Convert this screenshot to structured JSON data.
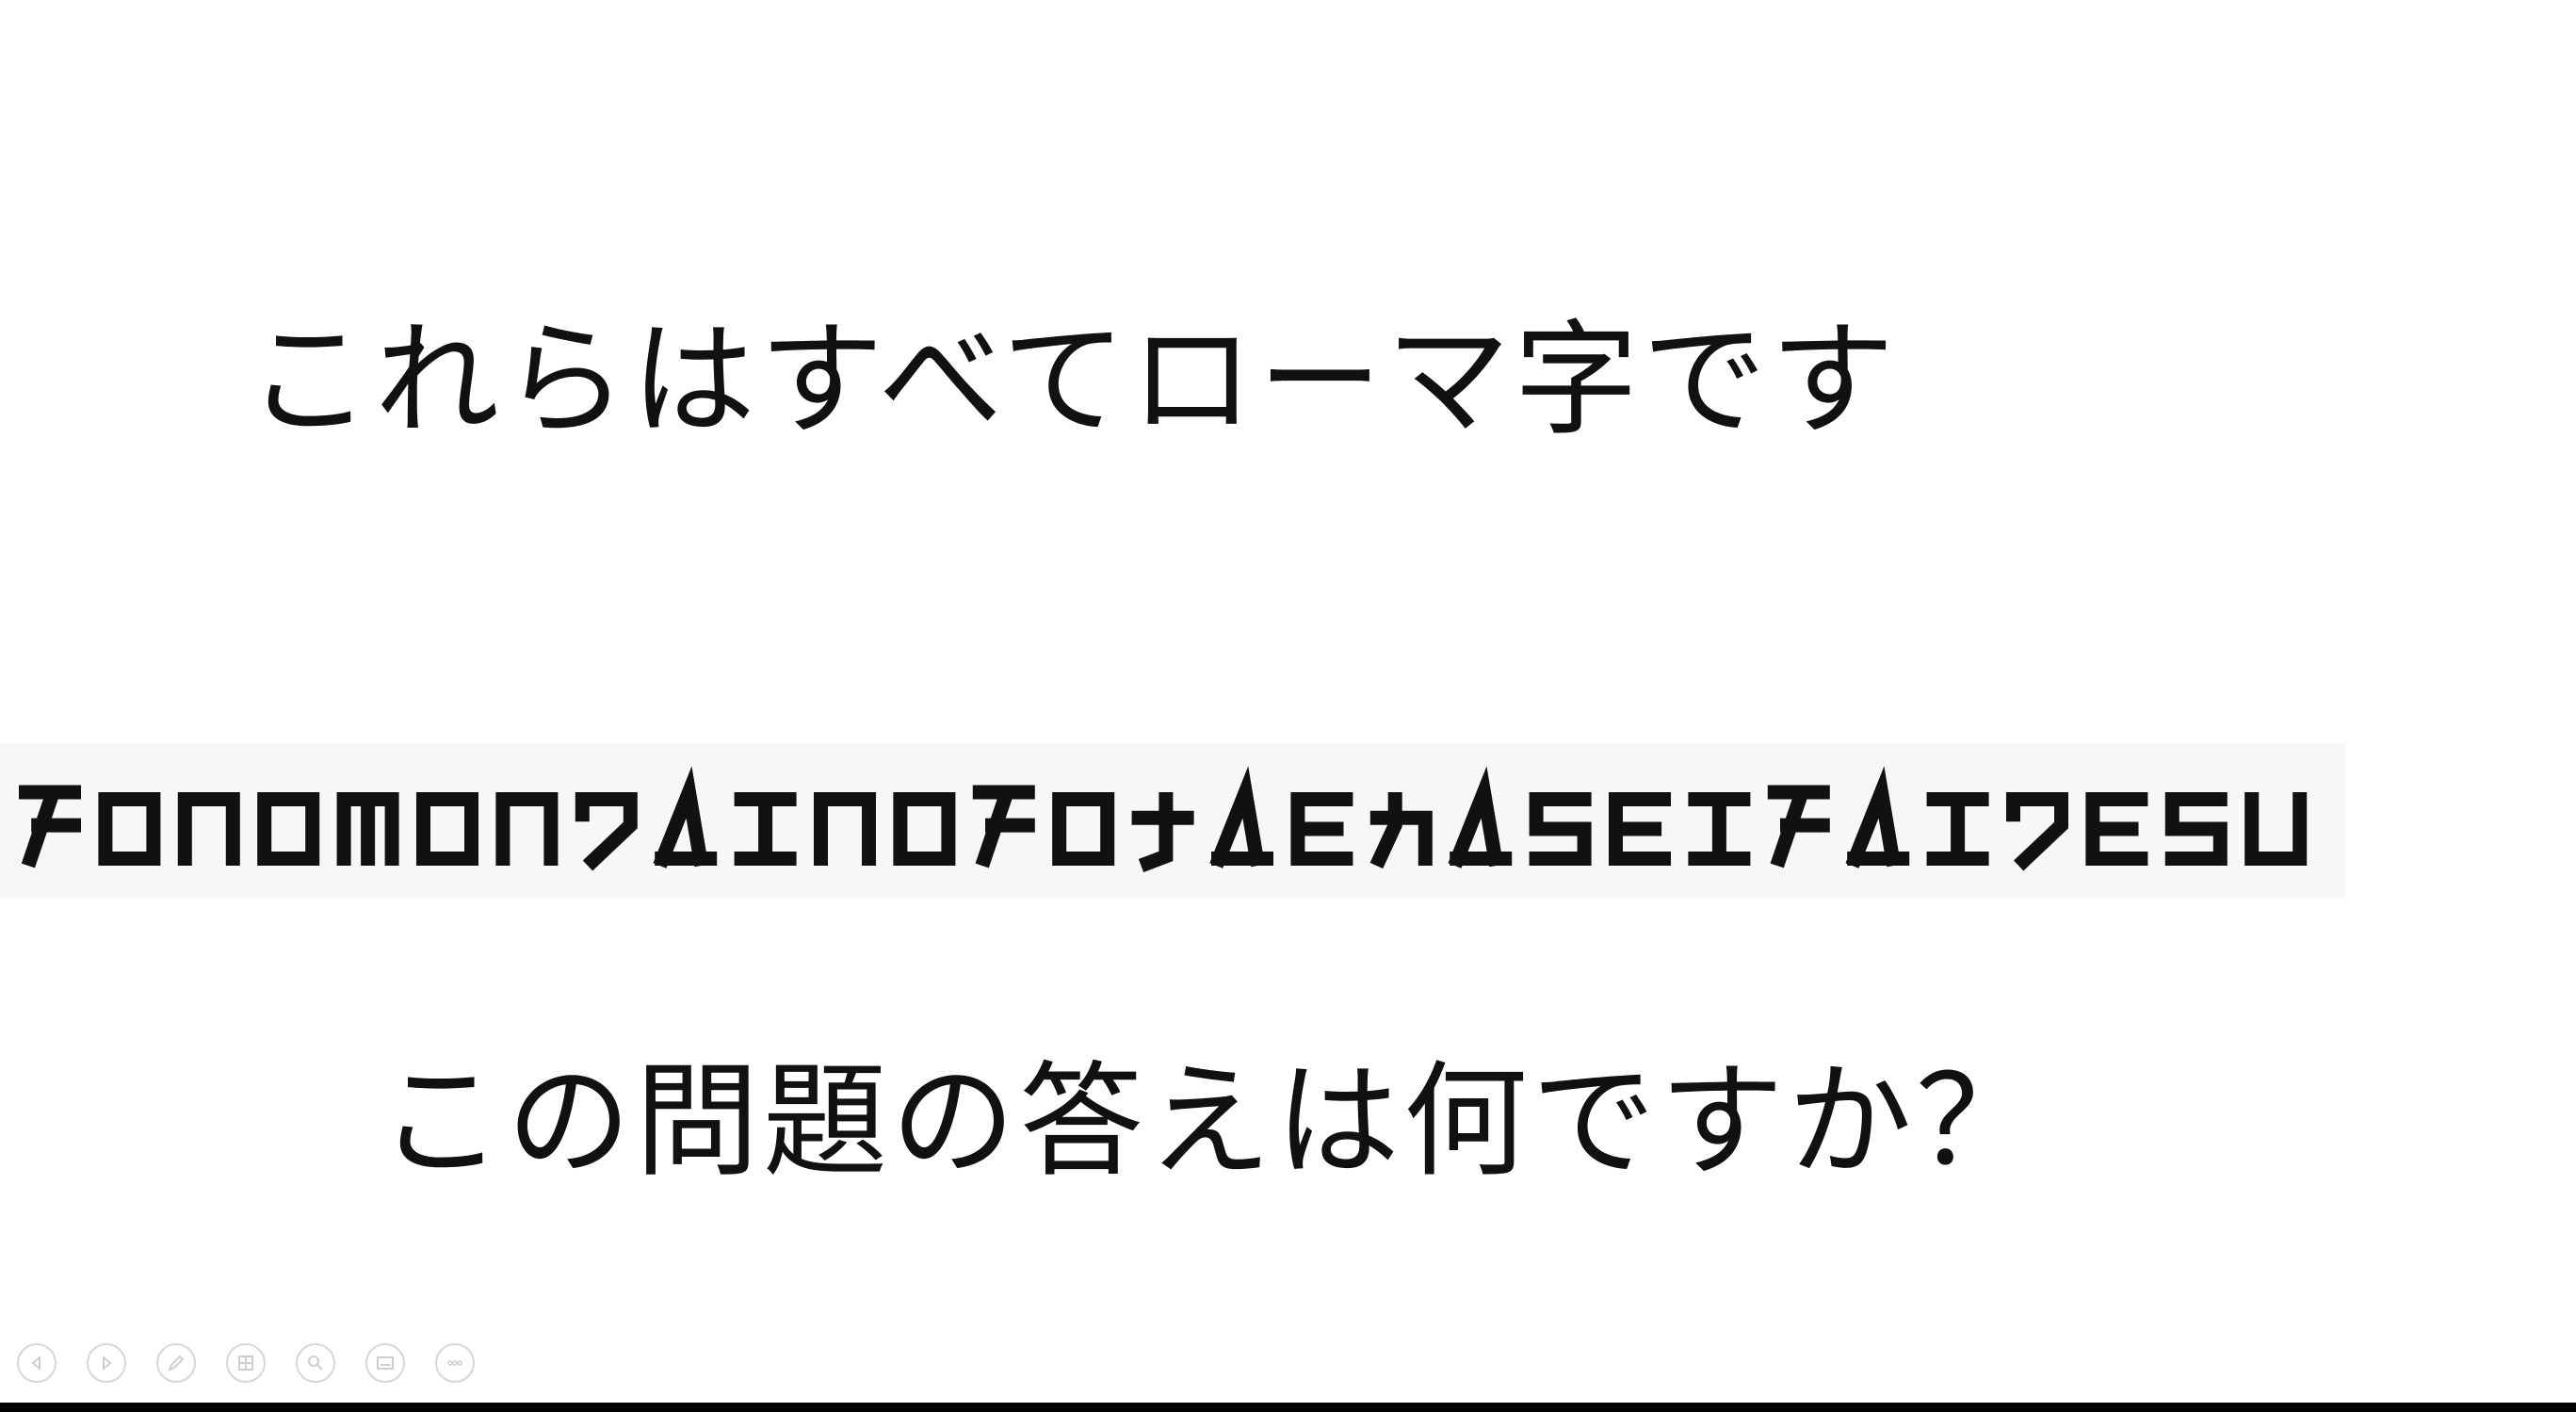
{
  "slide": {
    "line1": "これらはすべてローマ字です",
    "cipher_text": "KONOMONDAINOKOTAEHASEIKAIDESU",
    "line3": "この問題の答えは何ですか？"
  },
  "colors": {
    "text": "#111111",
    "cipher_glyph": "#111111",
    "cipher_background": "#f7f7f7",
    "control_outline": "#d6d6d6",
    "bottom_bar": "#000000"
  },
  "controls": [
    {
      "name": "previous-slide-button",
      "icon": "arrow-left-icon"
    },
    {
      "name": "next-slide-button",
      "icon": "arrow-right-icon"
    },
    {
      "name": "pen-tool-button",
      "icon": "pen-icon"
    },
    {
      "name": "see-all-slides-button",
      "icon": "slides-grid-icon"
    },
    {
      "name": "zoom-button",
      "icon": "magnifier-icon"
    },
    {
      "name": "subtitles-button",
      "icon": "subtitles-icon"
    },
    {
      "name": "more-options-button",
      "icon": "more-icon"
    }
  ]
}
